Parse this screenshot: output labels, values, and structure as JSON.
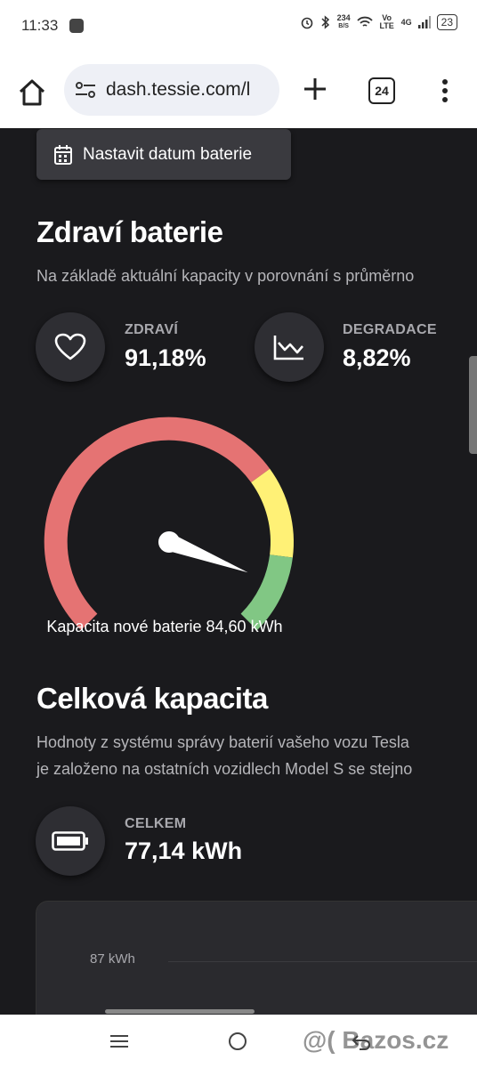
{
  "status_bar": {
    "time": "11:33",
    "speed_top": "234",
    "speed_bottom": "B/S",
    "network": "Vo LTE",
    "signal": "4G",
    "battery": "23"
  },
  "browser": {
    "url": "dash.tessie.com/l",
    "tab_count": "24"
  },
  "set_date_button": "Nastavit datum baterie",
  "battery_health": {
    "title": "Zdraví baterie",
    "description": "Na základě aktuální kapacity v porovnání s průměrno",
    "health": {
      "label": "ZDRAVÍ",
      "value": "91,18%",
      "icon": "heart-icon"
    },
    "degradation": {
      "label": "DEGRADACE",
      "value": "8,82%",
      "icon": "trend-down-icon"
    },
    "gauge": {
      "value_percent": 91.18,
      "caption": "Kapacita nové baterie 84,60 kWh",
      "colors": {
        "red": "#e57373",
        "yellow": "#fff176",
        "green": "#81c784"
      }
    }
  },
  "total_capacity": {
    "title": "Celková kapacita",
    "description_line1": "Hodnoty z systému správy baterií vašeho vozu Tesla",
    "description_line2": "je založeno na ostatních vozidlech Model S se stejno",
    "total": {
      "label": "CELKEM",
      "value": "77,14 kWh",
      "icon": "battery-icon"
    },
    "chart_tick": "87 kWh"
  },
  "watermark": "@( Bazos.cz"
}
